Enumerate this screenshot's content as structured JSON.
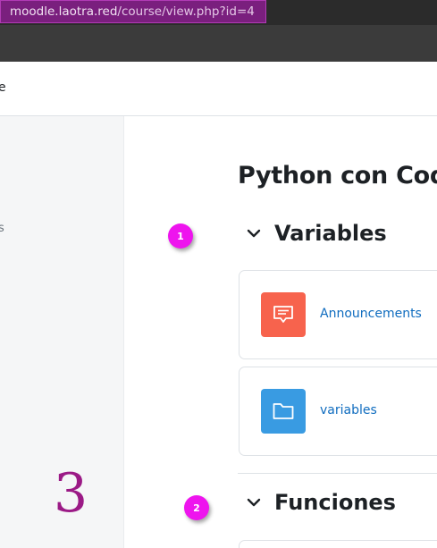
{
  "browser": {
    "url_host": "moodle.laotra.red",
    "url_path": "/course/view.php?id=4"
  },
  "navbar": {
    "partial_text": "e"
  },
  "drawer": {
    "partial_text": "s"
  },
  "course": {
    "title": "Python con Code"
  },
  "markers": {
    "m1": "1",
    "m2": "2",
    "big": "3"
  },
  "sections": [
    {
      "title": "Variables",
      "activities": [
        {
          "label": "Announcements",
          "icon": "forum-icon",
          "color": "#f7634d"
        },
        {
          "label": "variables",
          "icon": "folder-icon",
          "color": "#399be2"
        }
      ]
    },
    {
      "title": "Funciones",
      "activities": []
    }
  ]
}
